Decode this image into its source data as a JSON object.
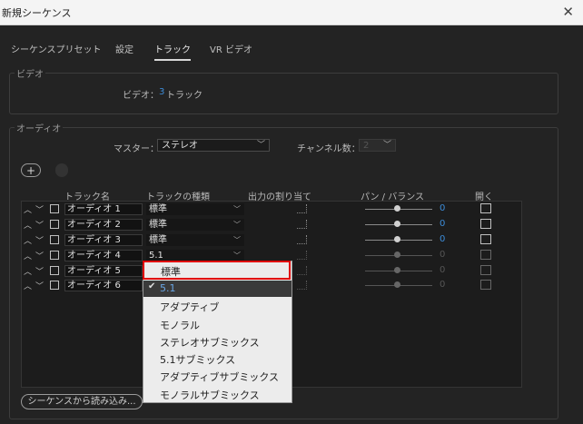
{
  "window": {
    "title": "新規シーケンス",
    "close_label": "✕"
  },
  "tabs": [
    {
      "label": "シーケンスプリセット"
    },
    {
      "label": "設定"
    },
    {
      "label": "トラック"
    },
    {
      "label": "VR ビデオ"
    }
  ],
  "active_tab": "トラック",
  "video": {
    "group_label": "ビデオ",
    "field_label": "ビデオ：",
    "count": "3",
    "unit": "トラック"
  },
  "audio": {
    "group_label": "オーディオ",
    "master_label": "マスター：",
    "master_value": "ステレオ",
    "channels_label": "チャンネル数：",
    "channels_value": "2",
    "add_button": "+",
    "remove_button": "-"
  },
  "columns": {
    "track_name": "トラック名",
    "track_type": "トラックの種類",
    "output": "出力の割り当て",
    "pan": "パン / バランス",
    "open": "開く"
  },
  "tracks": [
    {
      "name": "オーディオ 1",
      "type": "標準",
      "pan": "0"
    },
    {
      "name": "オーディオ 2",
      "type": "標準",
      "pan": "0"
    },
    {
      "name": "オーディオ 3",
      "type": "標準",
      "pan": "0"
    },
    {
      "name": "オーディオ 4",
      "type": "5.1",
      "pan": "0"
    },
    {
      "name": "オーディオ 5",
      "type": "",
      "pan": "0"
    },
    {
      "name": "オーディオ 6",
      "type": "",
      "pan": "0"
    }
  ],
  "dropdown": {
    "highlighted": "標準",
    "selected": "5.1",
    "options": [
      "アダプティブ",
      "モノラル",
      "ステレオサブミックス",
      "5.1サブミックス",
      "アダプティブサブミックス",
      "モノラルサブミックス"
    ]
  },
  "import_button": "シーケンスから読み込み...",
  "colors": {
    "accent_blue": "#3c8cd8",
    "highlight_red": "#e00000"
  }
}
